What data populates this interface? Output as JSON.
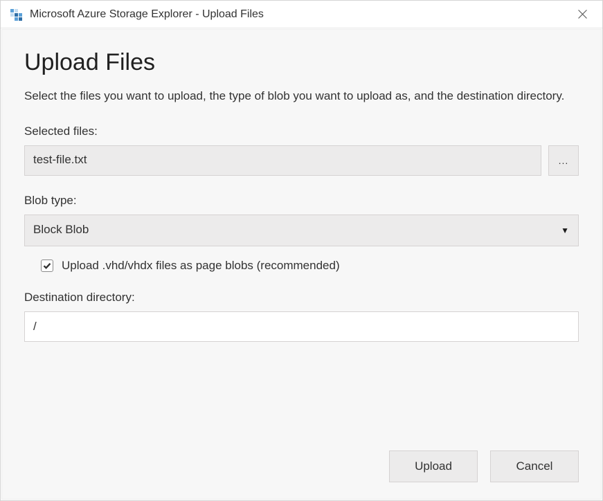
{
  "titlebar": {
    "title": "Microsoft Azure Storage Explorer - Upload Files"
  },
  "dialog": {
    "heading": "Upload Files",
    "description": "Select the files you want to upload, the type of blob you want to upload as, and the destination directory.",
    "selected_files_label": "Selected files:",
    "selected_files_value": "test-file.txt",
    "browse_label": "...",
    "blob_type_label": "Blob type:",
    "blob_type_value": "Block Blob",
    "vhd_checkbox_label": "Upload .vhd/vhdx files as page blobs (recommended)",
    "vhd_checkbox_checked": true,
    "destination_label": "Destination directory:",
    "destination_value": "/",
    "upload_button": "Upload",
    "cancel_button": "Cancel"
  }
}
